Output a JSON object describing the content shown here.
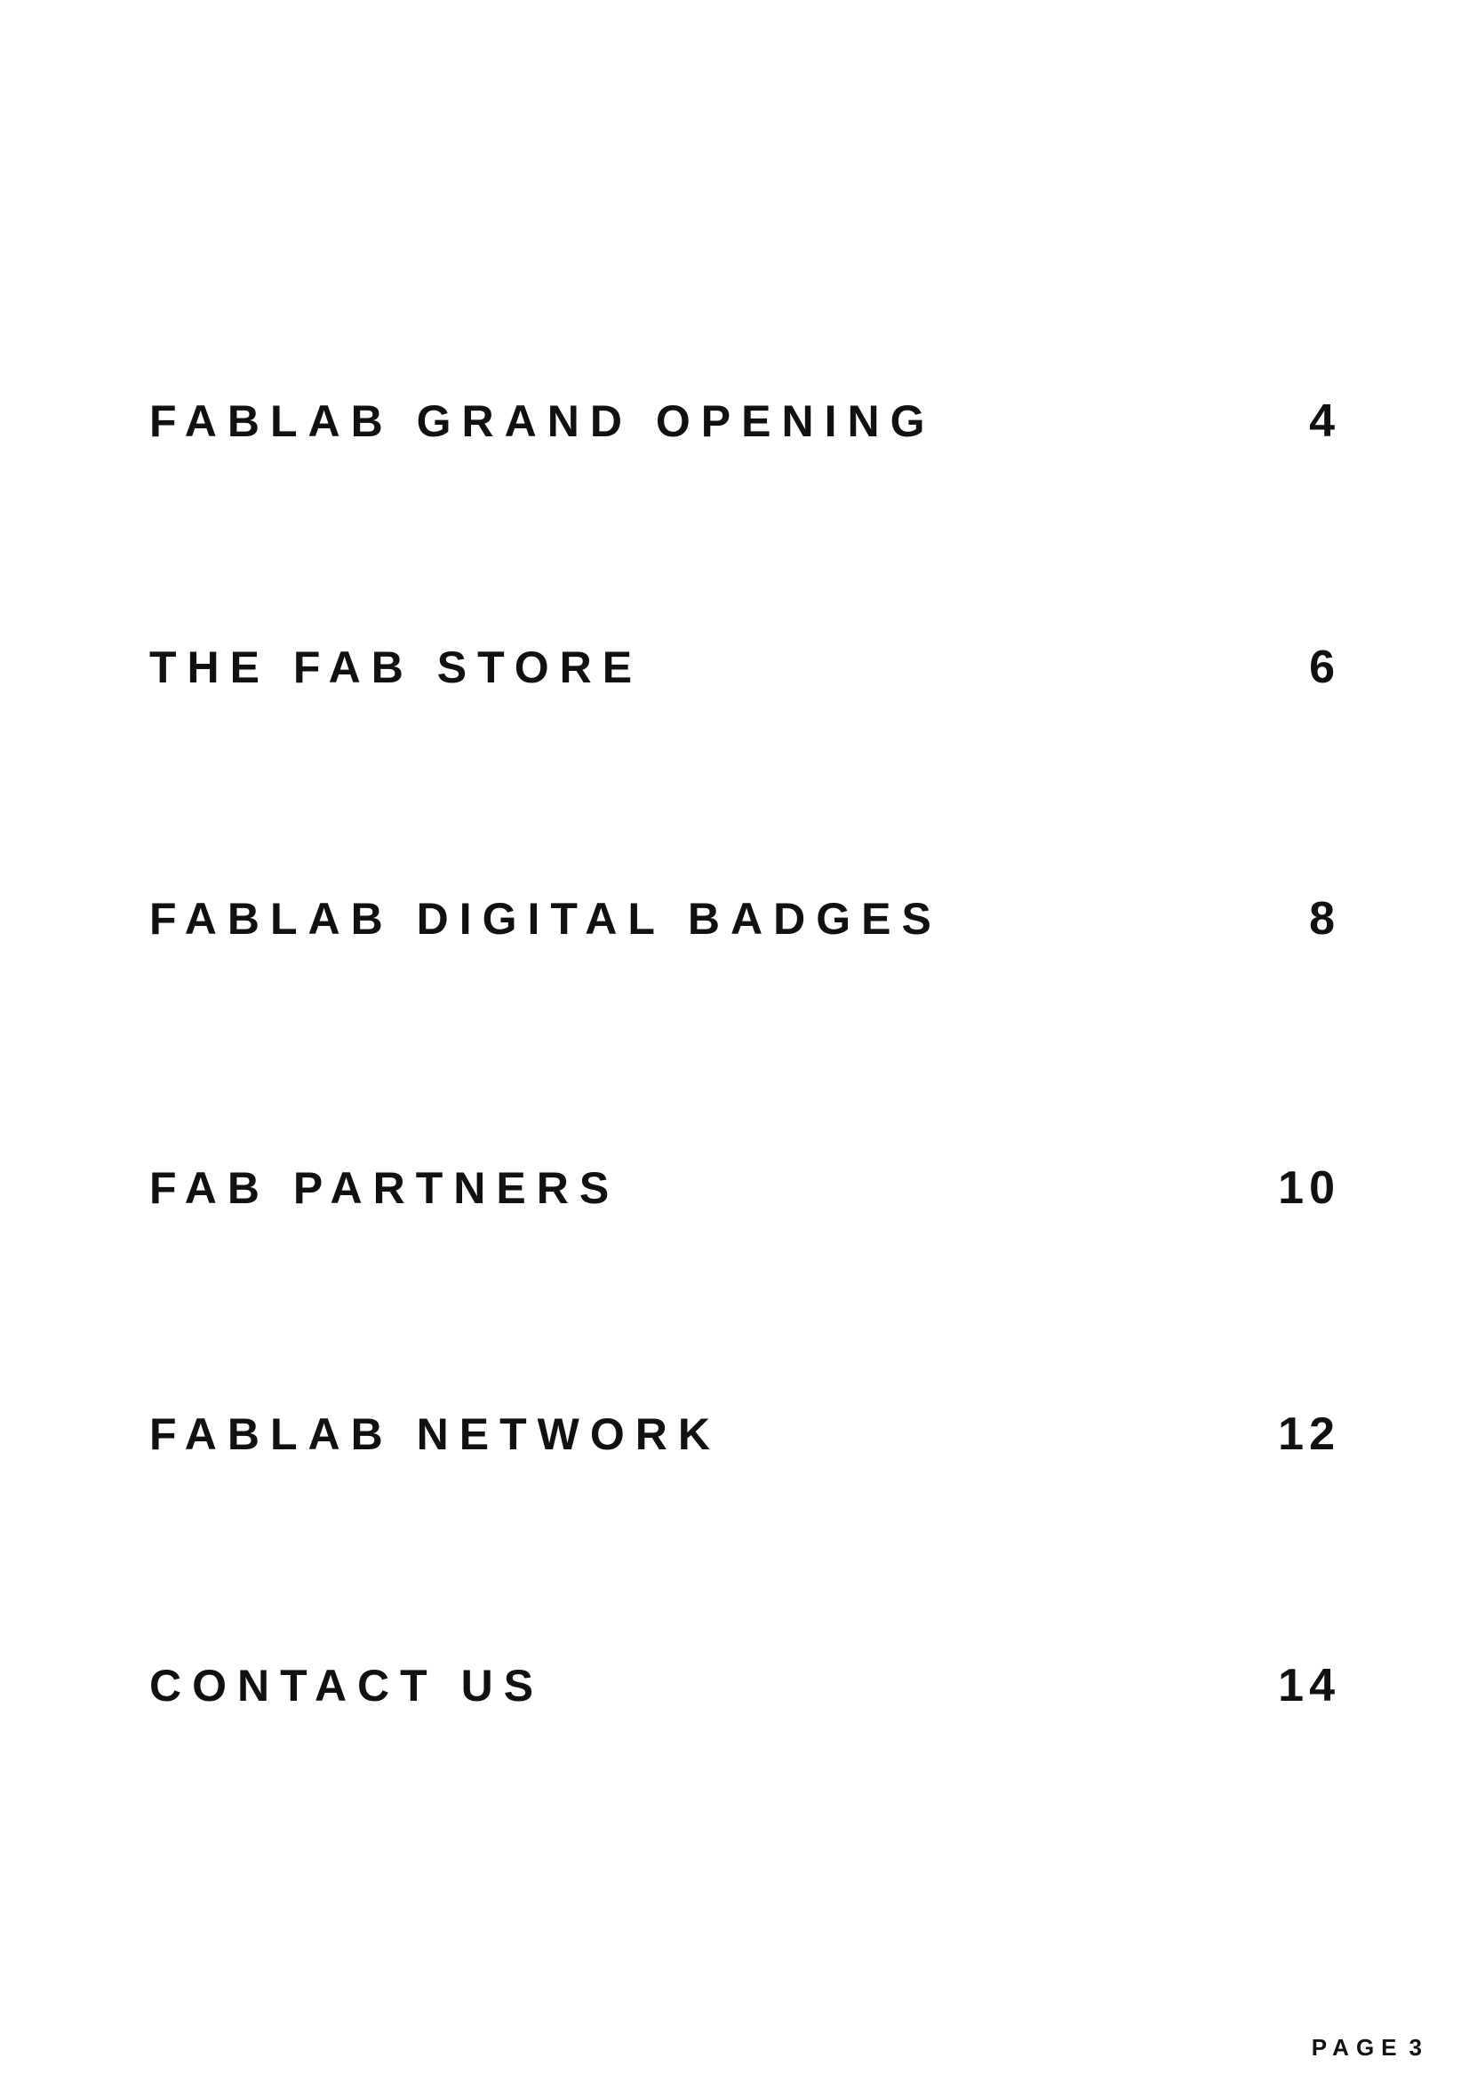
{
  "toc": {
    "entries": [
      {
        "title": "FABLAB GRAND OPENING",
        "page": "4"
      },
      {
        "title": "THE FAB STORE",
        "page": "6"
      },
      {
        "title": "FABLAB DIGITAL BADGES",
        "page": "8"
      },
      {
        "title": "FAB PARTNERS",
        "page": "10"
      },
      {
        "title": "FABLAB NETWORK",
        "page": "12"
      },
      {
        "title": "CONTACT US",
        "page": "14"
      }
    ]
  },
  "footer": {
    "label": "PAGE",
    "number": "3"
  }
}
